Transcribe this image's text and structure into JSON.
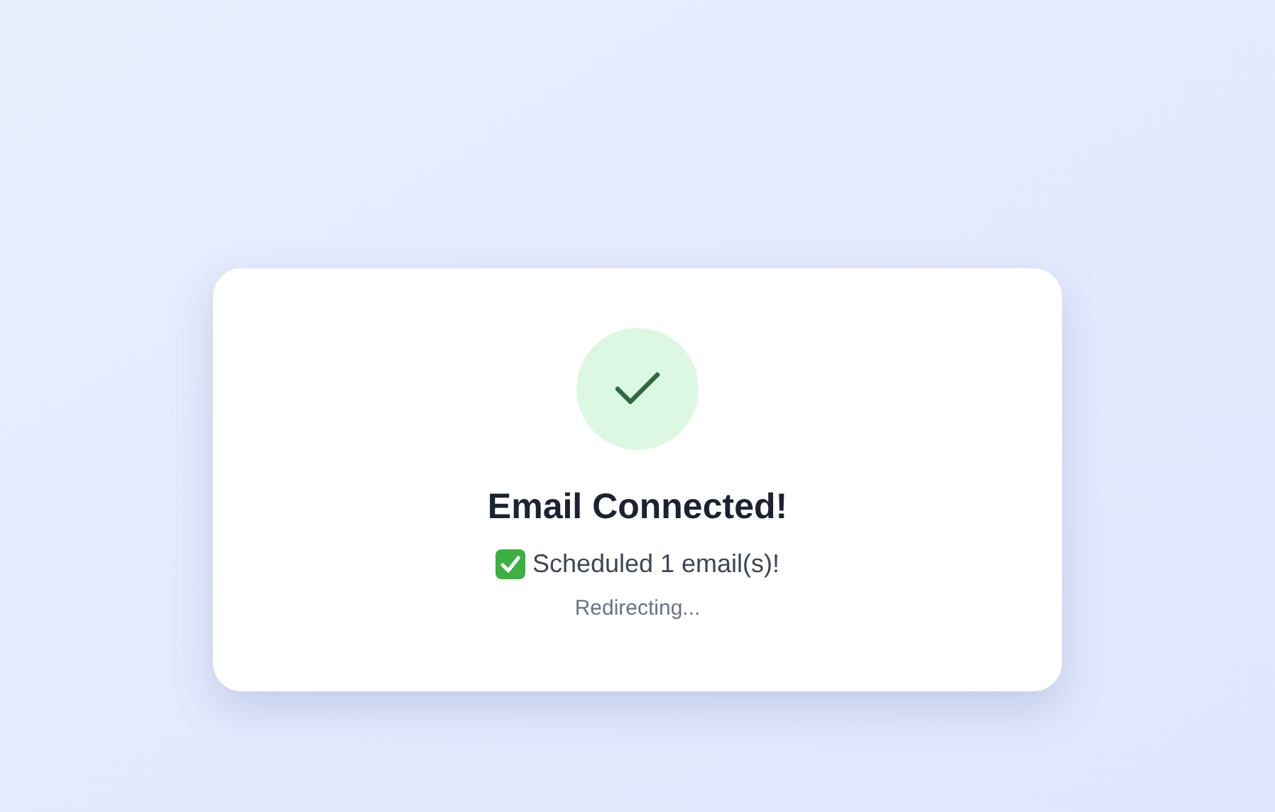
{
  "card": {
    "title": "Email Connected!",
    "message": "Scheduled 1 email(s)!",
    "status": "Redirecting..."
  }
}
